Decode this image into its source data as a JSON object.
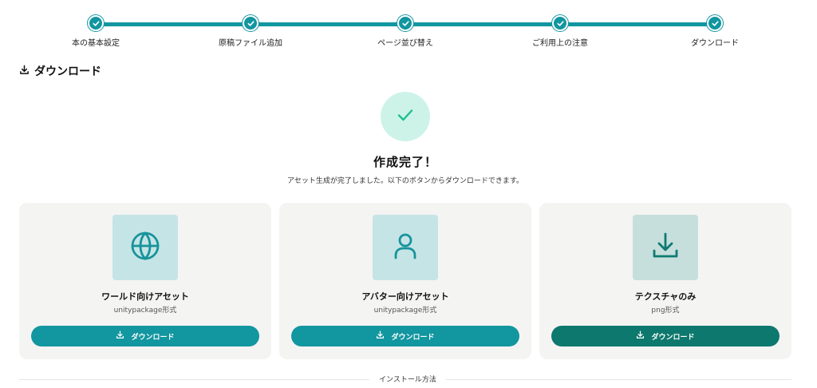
{
  "stepper": {
    "steps": [
      {
        "label": "本の基本設定"
      },
      {
        "label": "原稿ファイル追加"
      },
      {
        "label": "ページ並び替え"
      },
      {
        "label": "ご利用上の注意"
      },
      {
        "label": "ダウンロード"
      }
    ],
    "color": "#1296a0"
  },
  "section": {
    "title": "ダウンロード",
    "icon": "download-icon"
  },
  "completion": {
    "icon": "check-icon",
    "title": "作成完了！",
    "message": "アセット生成が完了しました。以下のボタンからダウンロードできます。",
    "circle_color": "#cdf3e8",
    "check_color": "#1fbf8f"
  },
  "cards": [
    {
      "icon": "globe-icon",
      "title": "ワールド向けアセット",
      "subtitle": "unitypackage形式",
      "button_label": "ダウンロード",
      "icon_bg": "#c5e4e6",
      "icon_color": "#17939b",
      "button_color": "#1296a0"
    },
    {
      "icon": "user-icon",
      "title": "アバター向けアセット",
      "subtitle": "unitypackage形式",
      "button_label": "ダウンロード",
      "icon_bg": "#c5e4e6",
      "icon_color": "#17939b",
      "button_color": "#1296a0"
    },
    {
      "icon": "download-icon",
      "title": "テクスチャのみ",
      "subtitle": "png形式",
      "button_label": "ダウンロード",
      "icon_bg": "#c6dfdc",
      "icon_color": "#0f7a72",
      "button_color": "#0d786d"
    }
  ],
  "install": {
    "label": "インストール方法"
  }
}
